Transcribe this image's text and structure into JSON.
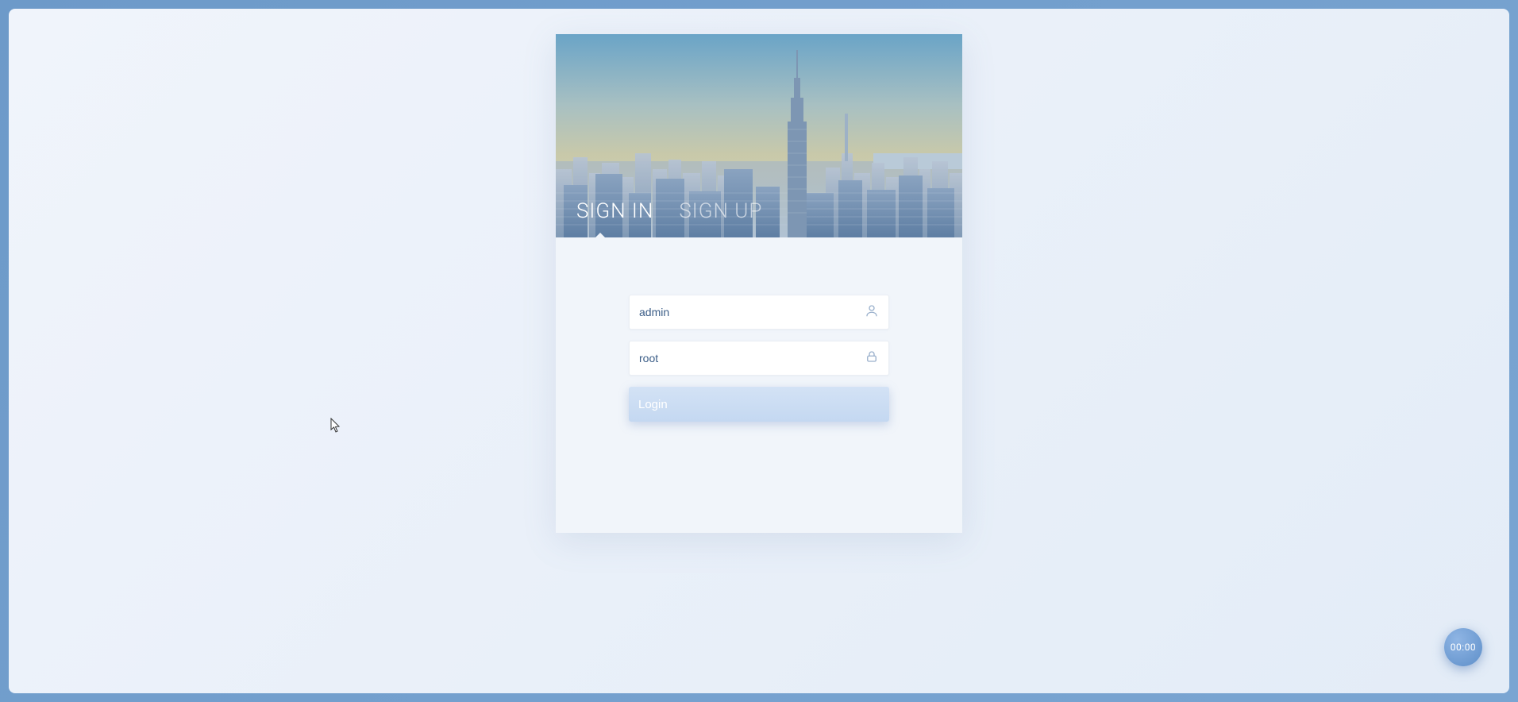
{
  "tabs": {
    "signin": "SIGN IN",
    "signup": "SIGN UP",
    "active": "signin"
  },
  "form": {
    "username_value": "admin",
    "password_value": "root",
    "login_label": "Login"
  },
  "timer": {
    "value": "00:00"
  }
}
